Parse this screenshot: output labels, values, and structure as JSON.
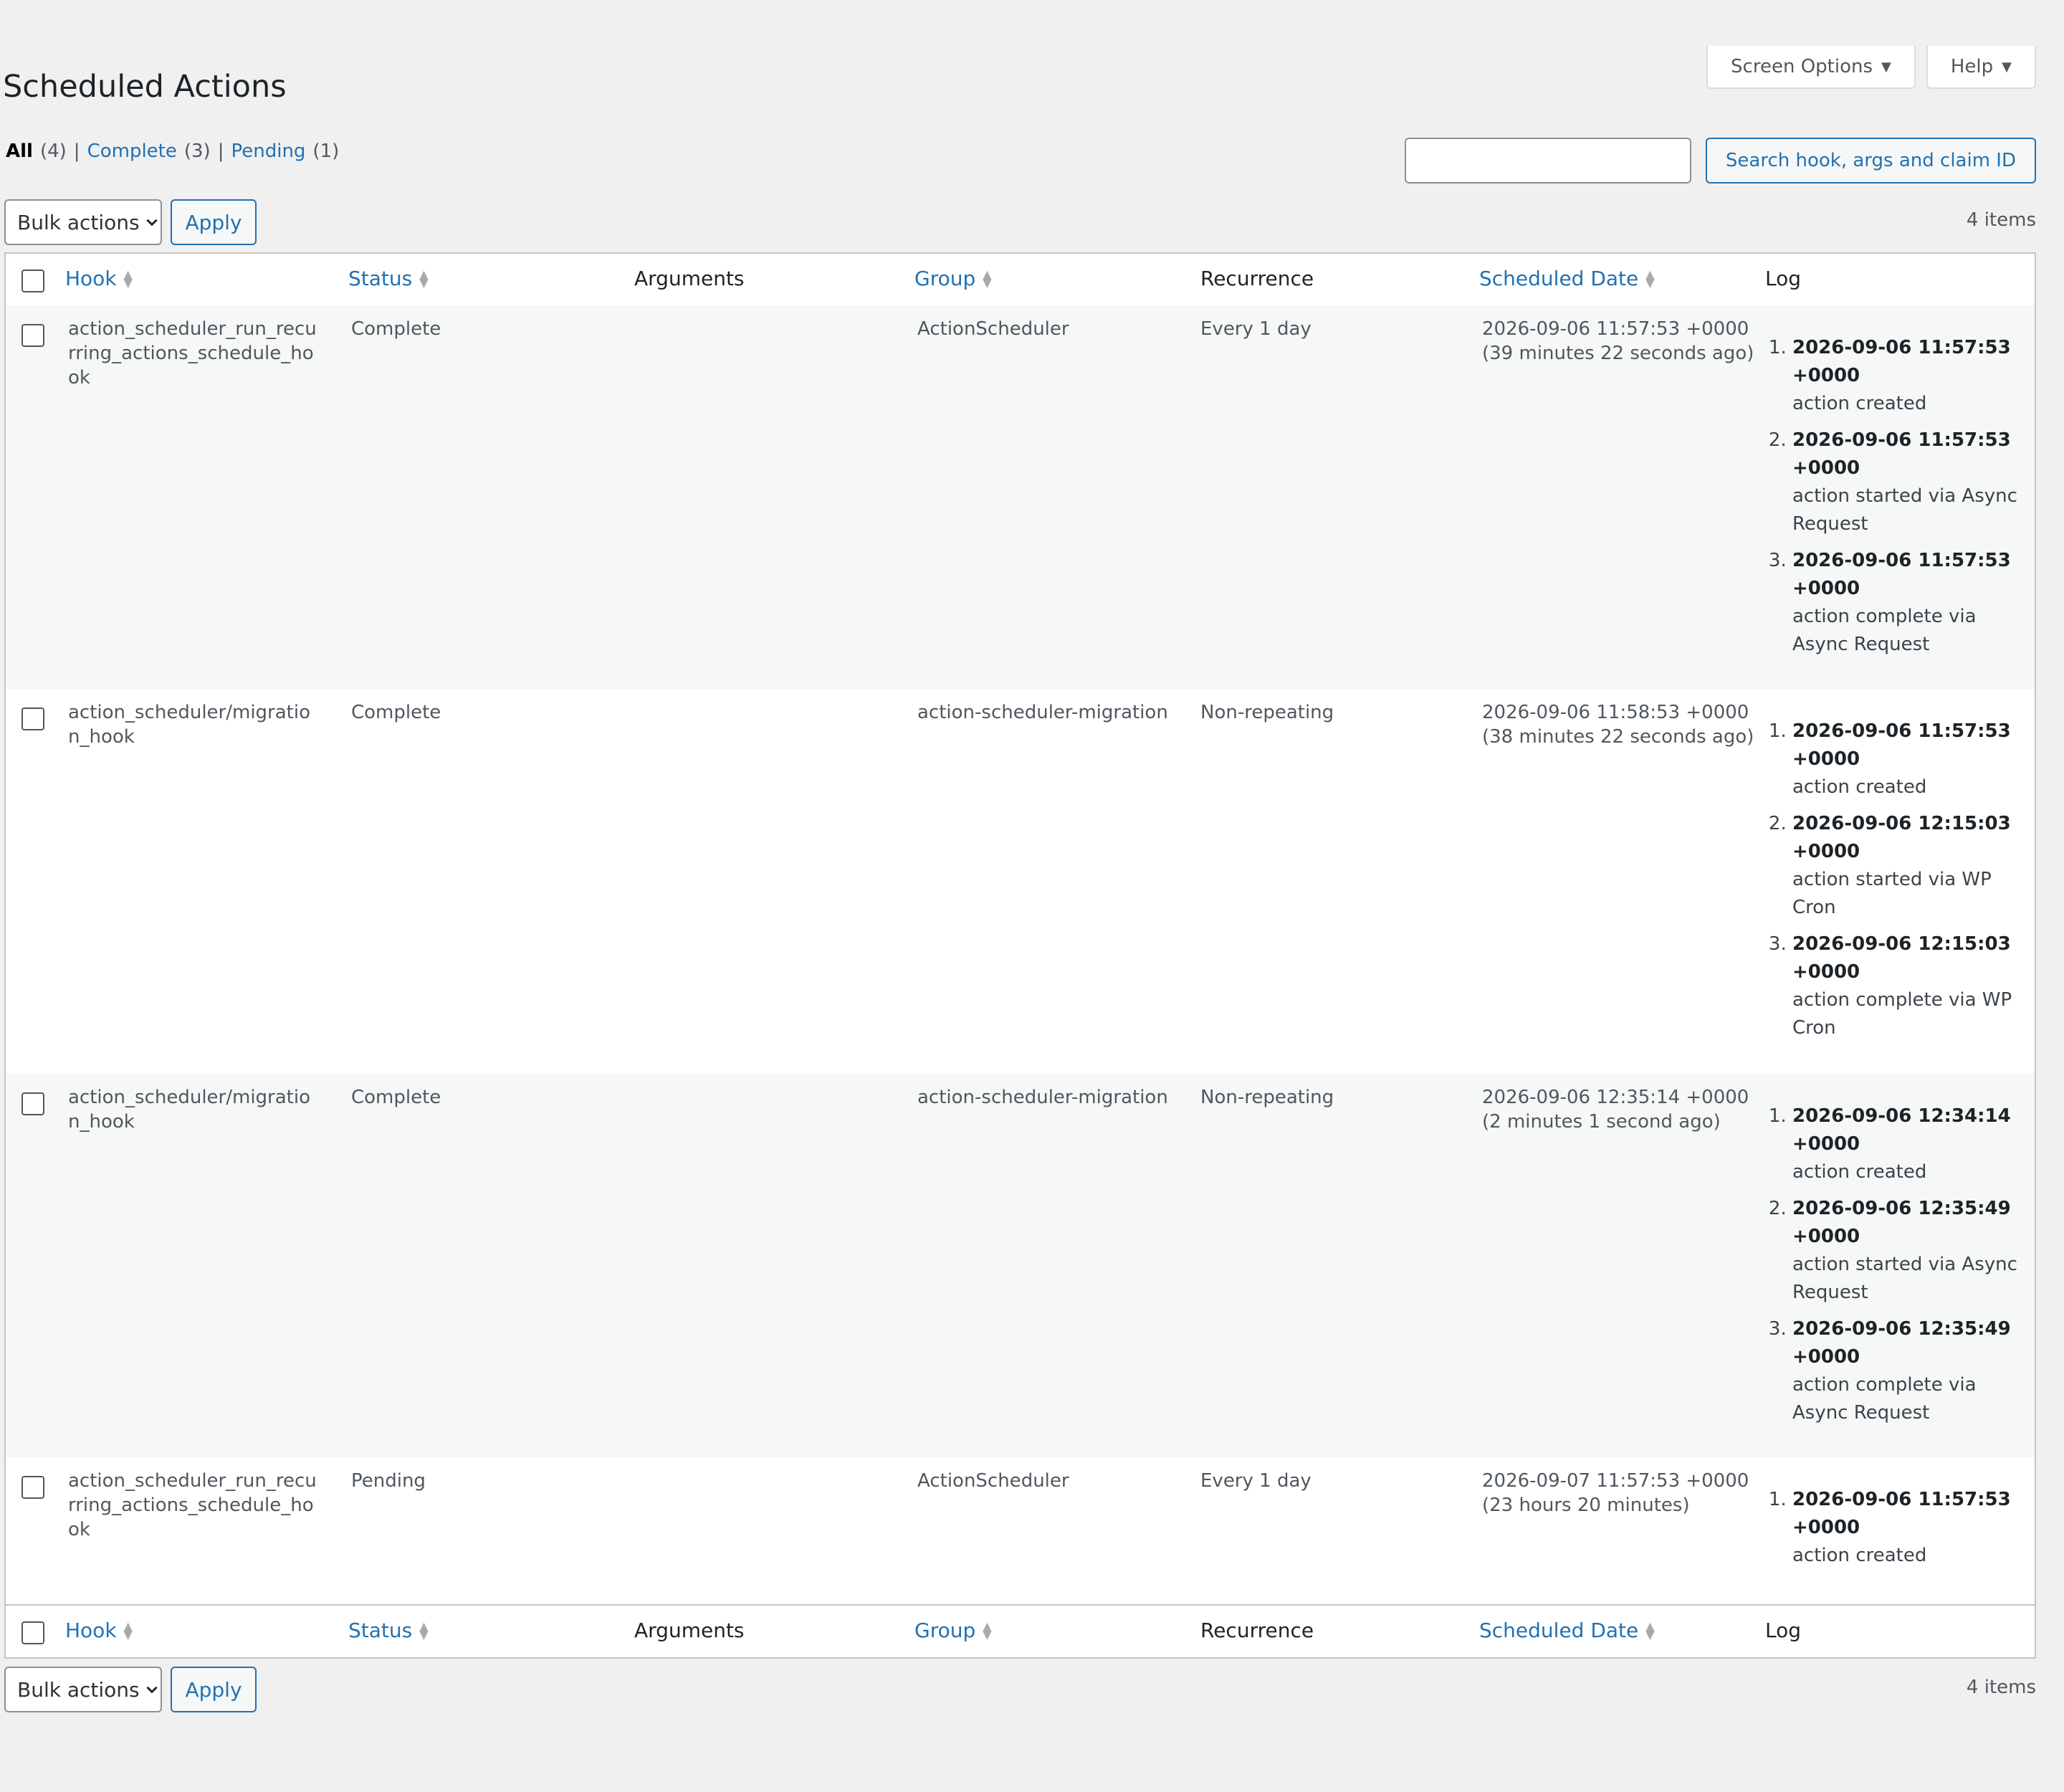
{
  "page": {
    "title": "Scheduled Actions"
  },
  "screen_meta": {
    "screen_options": "Screen Options",
    "help": "Help"
  },
  "filters": [
    {
      "label": "All",
      "count": "(4)"
    },
    {
      "label": "Complete",
      "count": "(3)"
    },
    {
      "label": "Pending",
      "count": "(1)"
    }
  ],
  "search": {
    "value": "",
    "button": "Search hook, args and claim ID"
  },
  "bulk": {
    "label": "Bulk actions",
    "apply": "Apply"
  },
  "items_count": "4 items",
  "columns": {
    "hook": "Hook",
    "status": "Status",
    "arguments": "Arguments",
    "group": "Group",
    "recurrence": "Recurrence",
    "scheduled_date": "Scheduled Date",
    "log": "Log"
  },
  "rows": [
    {
      "hook": "action_scheduler_run_recurring_actions_schedule_hook",
      "status": "Complete",
      "group": "ActionScheduler",
      "recurrence": "Every 1 day",
      "date": "2026-09-06 11:57:53 +0000",
      "relative": "(39 minutes 22 seconds ago)",
      "log": [
        {
          "time": "2026-09-06 11:57:53 +0000",
          "msg": "action created"
        },
        {
          "time": "2026-09-06 11:57:53 +0000",
          "msg": "action started via Async Request"
        },
        {
          "time": "2026-09-06 11:57:53 +0000",
          "msg": "action complete via Async Request"
        }
      ]
    },
    {
      "hook": "action_scheduler/migration_hook",
      "status": "Complete",
      "group": "action-scheduler-migration",
      "recurrence": "Non-repeating",
      "date": "2026-09-06 11:58:53 +0000",
      "relative": "(38 minutes 22 seconds ago)",
      "log": [
        {
          "time": "2026-09-06 11:57:53 +0000",
          "msg": "action created"
        },
        {
          "time": "2026-09-06 12:15:03 +0000",
          "msg": "action started via WP Cron"
        },
        {
          "time": "2026-09-06 12:15:03 +0000",
          "msg": "action complete via WP Cron"
        }
      ]
    },
    {
      "hook": "action_scheduler/migration_hook",
      "status": "Complete",
      "group": "action-scheduler-migration",
      "recurrence": "Non-repeating",
      "date": "2026-09-06 12:35:14 +0000",
      "relative": "(2 minutes 1 second ago)",
      "log": [
        {
          "time": "2026-09-06 12:34:14 +0000",
          "msg": "action created"
        },
        {
          "time": "2026-09-06 12:35:49 +0000",
          "msg": "action started via Async Request"
        },
        {
          "time": "2026-09-06 12:35:49 +0000",
          "msg": "action complete via Async Request"
        }
      ]
    },
    {
      "hook": "action_scheduler_run_recurring_actions_schedule_hook",
      "status": "Pending",
      "group": "ActionScheduler",
      "recurrence": "Every 1 day",
      "date": "2026-09-07 11:57:53 +0000",
      "relative": "(23 hours 20 minutes)",
      "log": [
        {
          "time": "2026-09-06 11:57:53 +0000",
          "msg": "action created"
        }
      ]
    }
  ]
}
